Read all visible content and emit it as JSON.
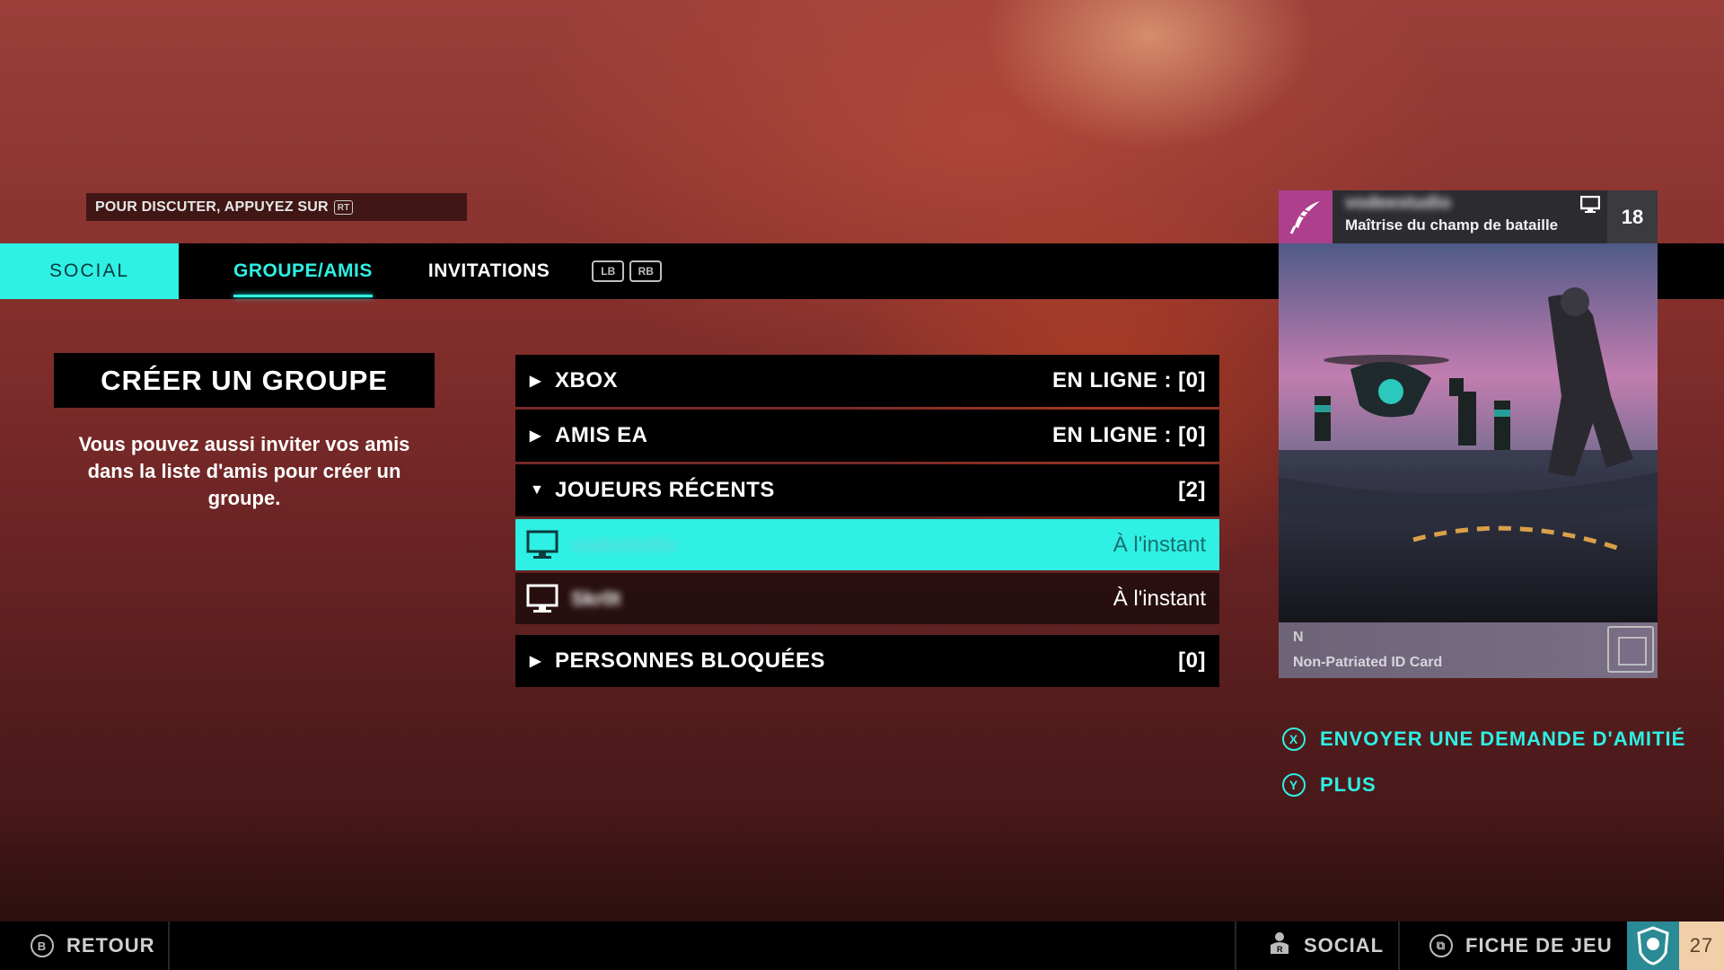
{
  "chat_hint": {
    "text": "POUR DISCUTER, APPUYEZ SUR",
    "button": "RT"
  },
  "tabs": {
    "social": "SOCIAL",
    "group_friends": "GROUPE/AMIS",
    "invitations": "INVITATIONS",
    "bumper_left": "LB",
    "bumper_right": "RB"
  },
  "create_group": {
    "title": "CRÉER UN GROUPE",
    "description": "Vous pouvez aussi inviter vos amis dans la liste d'amis pour créer un groupe."
  },
  "friend_list": {
    "xbox": {
      "label": "XBOX",
      "status": "EN LIGNE : [0]",
      "expanded": false
    },
    "ea_friends": {
      "label": "AMIS EA",
      "status": "EN LIGNE : [0]",
      "expanded": false
    },
    "recent_players": {
      "label": "JOUEURS RÉCENTS",
      "count": "[2]",
      "expanded": true,
      "players": [
        {
          "name": "vodestudio",
          "time": "À l'instant",
          "platform": "pc-icon",
          "selected": true
        },
        {
          "name": "Skr0t",
          "time": "À l'instant",
          "platform": "pc-icon",
          "selected": false
        }
      ]
    },
    "blocked": {
      "label": "PERSONNES BLOQUÉES",
      "count": "[0]",
      "expanded": false
    }
  },
  "profile_card": {
    "username": "vodeestudio",
    "title": "Maîtrise du champ de bataille",
    "level": "18",
    "card_name": "Non-Patriated ID Card",
    "emblem_color": "#ad3f8d"
  },
  "actions": {
    "send_friend_request": {
      "button": "X",
      "label": "ENVOYER UNE DEMANDE D'AMITIÉ"
    },
    "more": {
      "button": "Y",
      "label": "PLUS"
    }
  },
  "bottom_bar": {
    "back": {
      "button": "B",
      "label": "RETOUR"
    },
    "social": {
      "label": "SOCIAL"
    },
    "game_sheet": {
      "label": "FICHE DE JEU"
    },
    "rank": "27"
  },
  "colors": {
    "accent": "#2ef0e4",
    "bar": "#000000"
  }
}
